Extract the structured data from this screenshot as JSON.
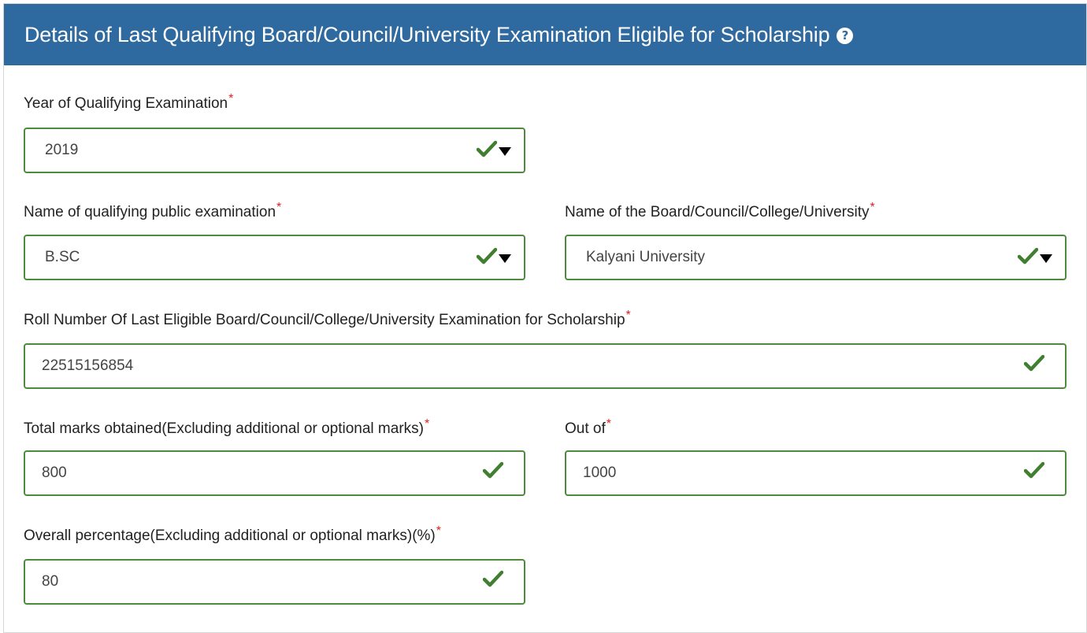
{
  "header": {
    "title": "Details of Last Qualifying Board/Council/University Examination Eligible for Scholarship",
    "help_icon": "?"
  },
  "required_mark": "*",
  "fields": {
    "year": {
      "label": "Year of Qualifying Examination",
      "value": "2019",
      "type": "select"
    },
    "exam_name": {
      "label": "Name of qualifying public examination",
      "value": "B.SC",
      "type": "select"
    },
    "board": {
      "label": "Name of the Board/Council/College/University",
      "value": "Kalyani University",
      "type": "select"
    },
    "roll": {
      "label": "Roll Number Of Last Eligible Board/Council/College/University Examination for Scholarship",
      "value": "22515156854",
      "type": "text"
    },
    "marks": {
      "label": "Total marks obtained(Excluding additional or optional marks)",
      "value": "800",
      "type": "text"
    },
    "out_of": {
      "label": "Out of",
      "value": "1000",
      "type": "text"
    },
    "percentage": {
      "label": "Overall percentage(Excluding additional or optional marks)(%)",
      "value": "80",
      "type": "text"
    }
  },
  "colors": {
    "header_bg": "#2e6aa0",
    "valid_border": "#4e8a3e",
    "check": "#3f7f2f",
    "required": "#e02020"
  },
  "icons": {
    "valid": "checkmark-icon",
    "dropdown": "caret-down-icon",
    "help": "question-circle-icon"
  }
}
